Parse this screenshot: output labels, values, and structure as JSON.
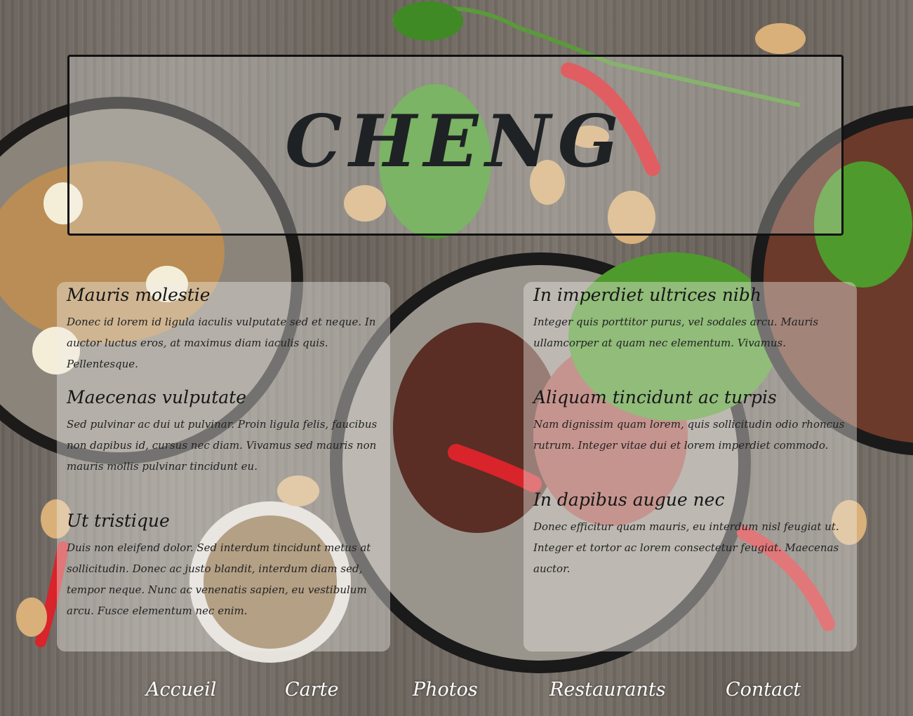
{
  "site": {
    "title": "CHENG"
  },
  "sections_left": [
    {
      "heading": "Mauris molestie",
      "text": "Donec id lorem id ligula iaculis vulputate sed et neque. In auctor luctus eros, at maximus diam iaculis quis. Pellentesque."
    },
    {
      "heading": "Maecenas vulputate",
      "text": "Sed pulvinar ac dui ut pulvinar. Proin ligula felis, faucibus non dapibus id, cursus nec diam. Vivamus sed mauris non mauris mollis pulvinar tincidunt eu."
    },
    {
      "heading": "Ut tristique",
      "text": "Duis non eleifend dolor. Sed interdum tincidunt metus at sollicitudin. Donec ac justo blandit, interdum diam sed, tempor neque. Nunc ac venenatis sapien, eu vestibulum arcu. Fusce elementum nec enim."
    }
  ],
  "sections_right": [
    {
      "heading": "In imperdiet ultrices nibh",
      "text": "Integer quis porttitor purus, vel sodales arcu. Mauris ullamcorper at quam nec elementum. Vivamus."
    },
    {
      "heading": "Aliquam tincidunt ac turpis",
      "text": "Nam dignissim quam lorem, quis sollicitudin odio rhoncus rutrum. Integer vitae dui et lorem imperdiet commodo."
    },
    {
      "heading": "In dapibus augue nec",
      "text": "Donec efficitur quam mauris, eu interdum nisl feugiat ut. Integer et tortor ac lorem consectetur feugiat. Maecenas auctor."
    }
  ],
  "nav": {
    "items": [
      "Accueil",
      "Carte",
      "Photos",
      "Restaurants",
      "Contact"
    ]
  },
  "colors": {
    "title_text": "#1f2224",
    "nav_text": "#ffffff",
    "header_border": "#111111"
  }
}
